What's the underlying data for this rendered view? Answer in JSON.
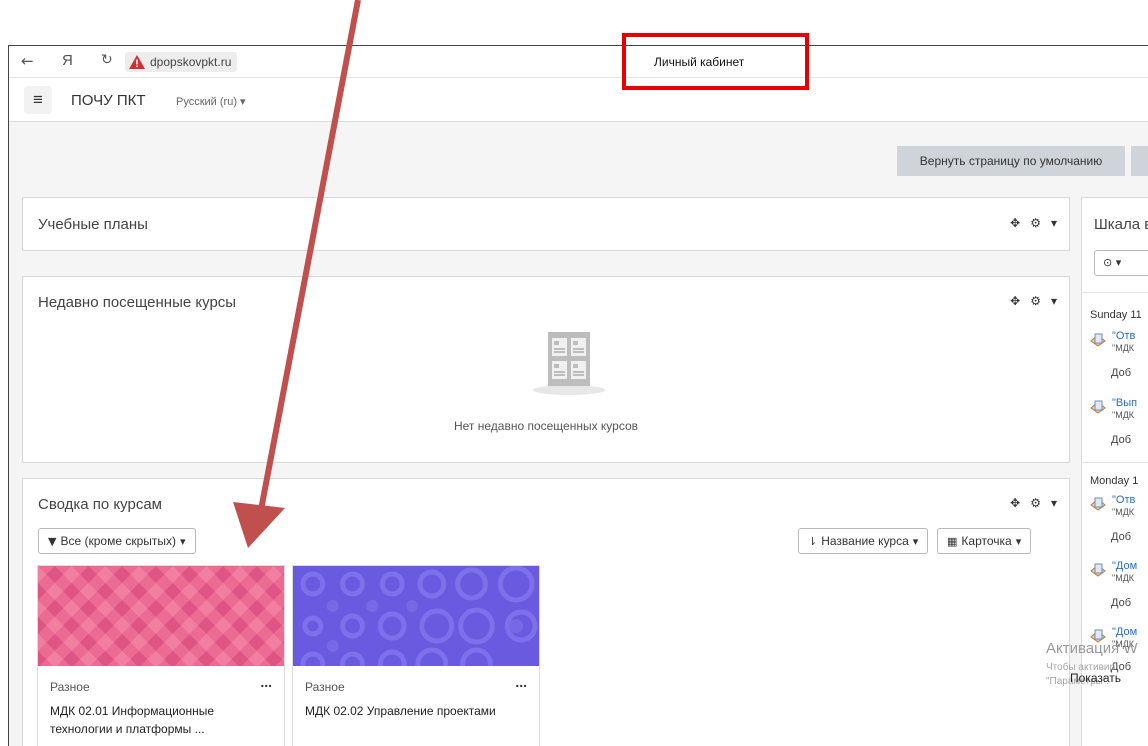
{
  "browser": {
    "address": "dpopskovpkt.ru",
    "tab_title": "Личный кабинет",
    "yandex_glyph": "Я"
  },
  "site": {
    "brand": "ПОЧУ ПКТ",
    "language": "Русский (ru)",
    "reset_button": "Вернуть страницу по умолчанию"
  },
  "blocks": {
    "learning_plans": {
      "title": "Учебные планы"
    },
    "recent_courses": {
      "title": "Недавно посещенные курсы",
      "empty_text": "Нет недавно посещенных курсов"
    },
    "course_overview": {
      "title": "Сводка по курсам",
      "filter_label": "Все (кроме скрытых)",
      "sort_label": "Название курса",
      "view_label": "Карточка",
      "courses": [
        {
          "category": "Разное",
          "name": "МДК 02.01 Информационные технологии и платформы ...",
          "more": "..."
        },
        {
          "category": "Разное",
          "name": "МДК 02.02 Управление проектами",
          "more": "..."
        }
      ]
    }
  },
  "timeline": {
    "title": "Шкала в",
    "days": [
      {
        "date": "Sunday 11",
        "items": [
          {
            "link": "\"Отв",
            "sub": "\"МДК",
            "added": "Доб"
          },
          {
            "link": "\"Вып",
            "sub": "\"МДК",
            "added": "Доб"
          }
        ]
      },
      {
        "date": "Monday 1",
        "items": [
          {
            "link": "\"Отв",
            "sub": "\"МДК",
            "added": "Доб"
          },
          {
            "link": "\"Дом",
            "sub": "\"МДК",
            "added": "Доб"
          },
          {
            "link": "\"Дом",
            "sub": "\"МДК",
            "added": "Доб"
          }
        ]
      }
    ],
    "show_more": "Показать"
  },
  "windows_activation": {
    "title": "Активация W",
    "line1": "Чтобы активир",
    "line2": "\"Параметры\"."
  },
  "colors": {
    "annotation_red": "#e60000",
    "arrow": "#c0504d",
    "course1_pattern": "#ec6b93",
    "course2_pattern": "#6a5adf",
    "link": "#2a6ebb"
  }
}
